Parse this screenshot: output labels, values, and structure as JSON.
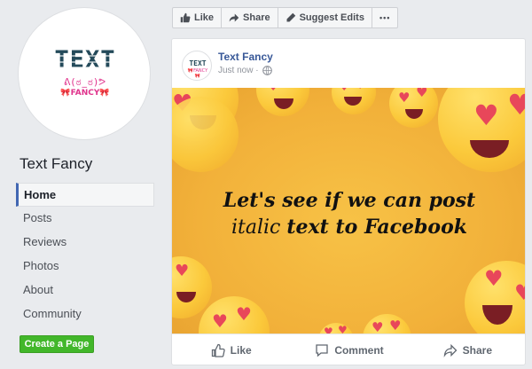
{
  "sidebar": {
    "logo": {
      "main": "TEXT",
      "sub": "ᕕ(ಠ_ಠ)ᕗ",
      "sub2": "🎀FANCY🎀"
    },
    "page_name": "Text Fancy",
    "nav": [
      {
        "label": "Home",
        "active": true
      },
      {
        "label": "Posts"
      },
      {
        "label": "Reviews"
      },
      {
        "label": "Photos"
      },
      {
        "label": "About"
      },
      {
        "label": "Community"
      }
    ],
    "create_page": "Create a Page"
  },
  "toolbar": {
    "like": "Like",
    "share": "Share",
    "suggest_edits": "Suggest Edits",
    "more": "•••"
  },
  "post": {
    "author": "Text Fancy",
    "time": "Just now ·",
    "headline": {
      "line1": "Let's see if we can post",
      "line2_a": "italic",
      "line2_b": "text to Facebook"
    },
    "actions": {
      "like": "Like",
      "comment": "Comment",
      "share": "Share"
    }
  },
  "colors": {
    "link": "#385898",
    "create_button": "#42b72a",
    "active_nav_accent": "#4267b2",
    "image_background": "#f2b13a"
  },
  "icons": [
    "thumbs-up-icon",
    "share-icon",
    "pencil-icon",
    "globe-icon",
    "comment-icon"
  ]
}
